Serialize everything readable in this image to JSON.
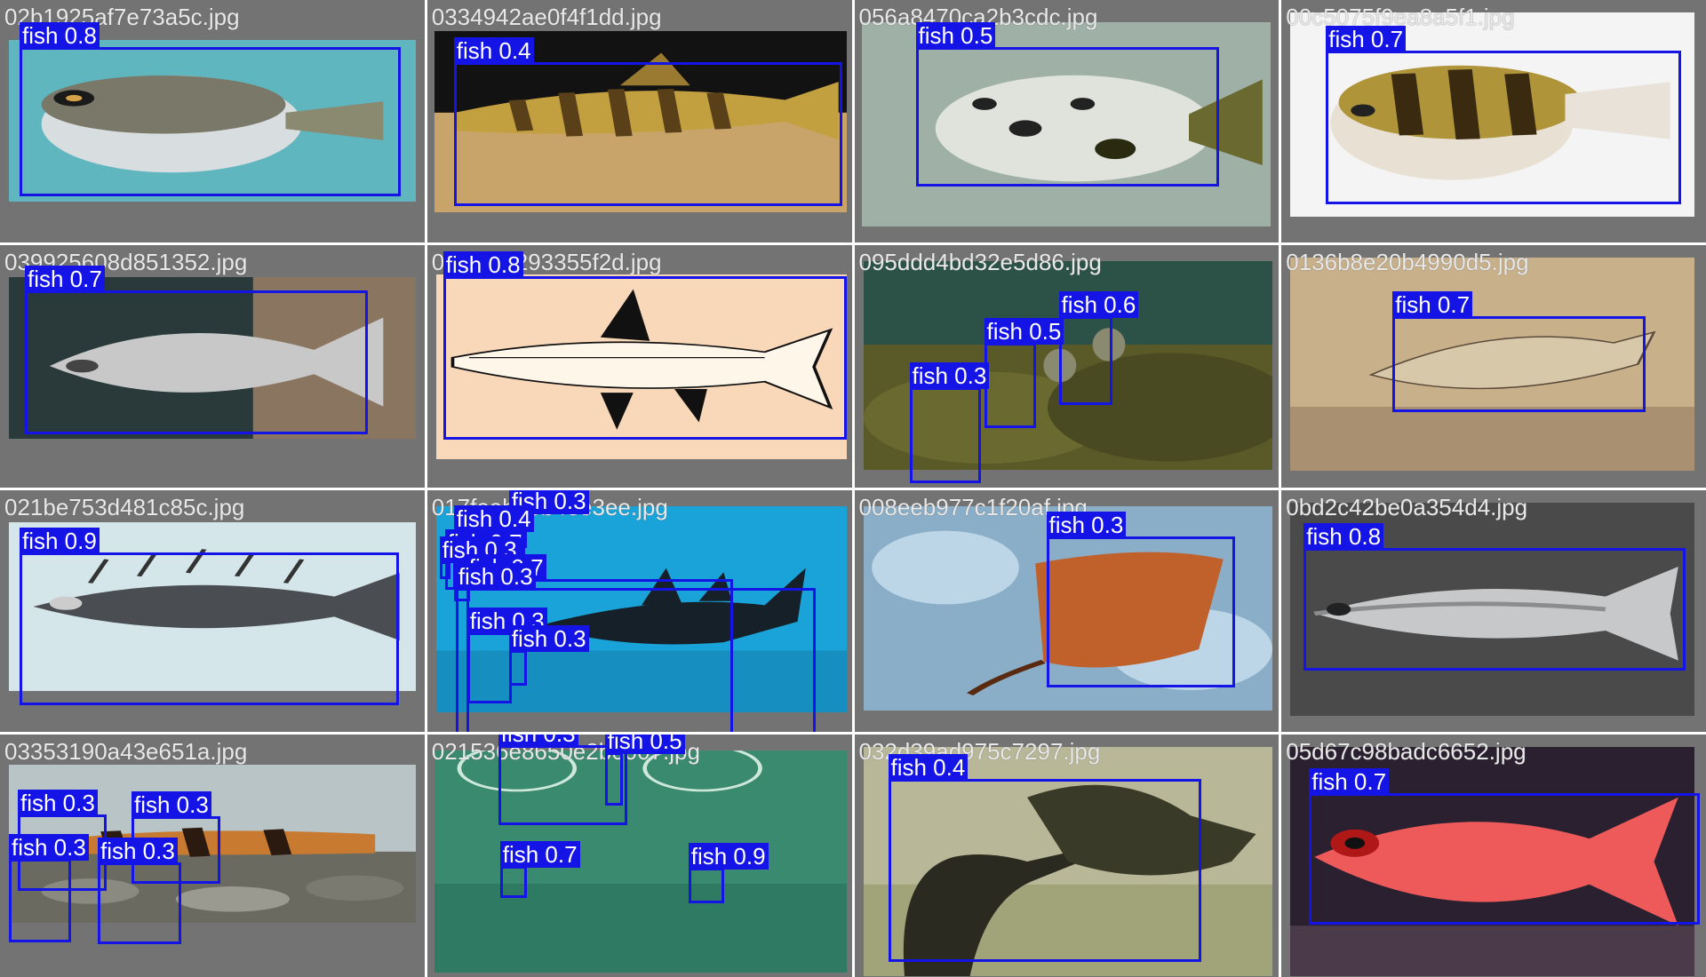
{
  "colors": {
    "box": "#1414e6",
    "label_text": "#ffffff",
    "tile_bg": "#737373",
    "filename_text": "#e8e8e8"
  },
  "tiles": [
    {
      "filename": "02b1925af7e73a5c.jpg",
      "scene": "pufferfish-on-blue",
      "detections": [
        {
          "label": "fish 0.8"
        }
      ]
    },
    {
      "filename": "0334942ae0f4f1dd.jpg",
      "scene": "loach-on-gravel",
      "detections": [
        {
          "label": "fish 0.4"
        }
      ]
    },
    {
      "filename": "056a8470ca2b3cdc.jpg",
      "scene": "spotted-puffer-underwater",
      "detections": [
        {
          "label": "fish 0.5"
        }
      ]
    },
    {
      "filename": "00c5075f9ea8a5f1.jpg",
      "scene": "banded-puffer-white",
      "detections": [
        {
          "label": "fish 0.7"
        }
      ]
    },
    {
      "filename": "039925608d851352.jpg",
      "scene": "silver-fish-dark",
      "detections": [
        {
          "label": "fish 0.7"
        }
      ]
    },
    {
      "filename": "0f8d0b8293355f2d.jpg",
      "scene": "fish-line-drawing",
      "detections": [
        {
          "label": "fish 0.8"
        }
      ]
    },
    {
      "filename": "095ddd4bd32e5d86.jpg",
      "scene": "reef-rocks",
      "detections": [
        {
          "label": "fish 0.6"
        },
        {
          "label": "fish 0.5"
        },
        {
          "label": "fish 0.3"
        }
      ]
    },
    {
      "filename": "0136b8e20b4990d5.jpg",
      "scene": "fish-sketch-sepia",
      "detections": [
        {
          "label": "fish 0.7"
        }
      ]
    },
    {
      "filename": "021be753d481c85c.jpg",
      "scene": "spiny-fish-pale",
      "detections": [
        {
          "label": "fish 0.9"
        }
      ]
    },
    {
      "filename": "017feab40b43e3ee.jpg",
      "scene": "shark-blue-water",
      "detections": [
        {
          "label": "fish 0.3"
        },
        {
          "label": "fish 0.4"
        },
        {
          "label": "fish 0.7"
        },
        {
          "label": "fish 0.3"
        },
        {
          "label": "fish 0.7"
        },
        {
          "label": "fish 0.3"
        },
        {
          "label": "fish 0.3"
        },
        {
          "label": "fish 0.3"
        }
      ]
    },
    {
      "filename": "008eeb977c1f20af.jpg",
      "scene": "ray-on-ice",
      "detections": [
        {
          "label": "fish 0.3"
        }
      ]
    },
    {
      "filename": "0bd2c42be0a354d4.jpg",
      "scene": "silver-fish-grey",
      "detections": [
        {
          "label": "fish 0.8"
        }
      ]
    },
    {
      "filename": "03353190a43e651a.jpg",
      "scene": "loaches-on-pebbles",
      "detections": [
        {
          "label": "fish 0.3"
        },
        {
          "label": "fish 0.3"
        },
        {
          "label": "fish 0.3"
        },
        {
          "label": "fish 0.3"
        }
      ]
    },
    {
      "filename": "021536e8650e2b0007.jpg",
      "scene": "green-tank",
      "detections": [
        {
          "label": "fish 0.3"
        },
        {
          "label": "fish 0.5"
        },
        {
          "label": "fish 0.7"
        },
        {
          "label": "fish 0.9"
        }
      ]
    },
    {
      "filename": "032d39ad975c7297.jpg",
      "scene": "cormorant-with-fish",
      "detections": [
        {
          "label": "fish 0.4"
        }
      ]
    },
    {
      "filename": "05d67c98badc6652.jpg",
      "scene": "red-bigeye-reef",
      "detections": [
        {
          "label": "fish 0.7"
        }
      ]
    }
  ]
}
